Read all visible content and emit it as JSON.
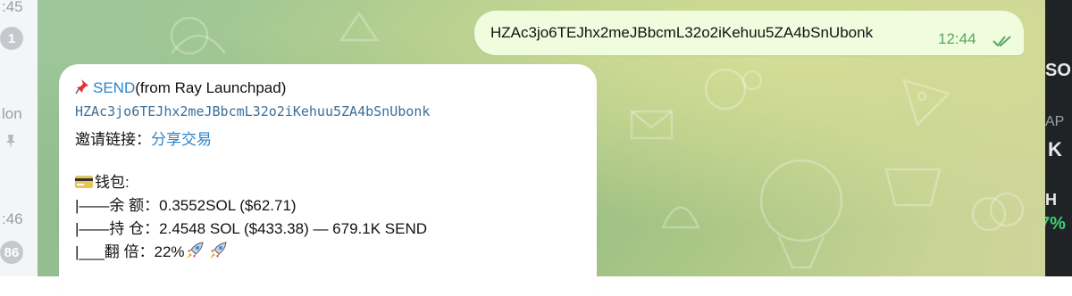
{
  "chat_list": {
    "time_1": ":45",
    "badge_1": "1",
    "name_fragment": "lon",
    "time_2": ":46",
    "badge_2": "86"
  },
  "right_panel": {
    "text_1": "SOL",
    "text_2": "AP",
    "text_3": "K",
    "text_4": "H",
    "text_5": "7%"
  },
  "outgoing_message": {
    "text": "HZAc3jo6TEJhx2meJBbcmL32o2iKehuu5ZA4bSnUbonk",
    "time": "12:44",
    "status_icon": "double-check-icon"
  },
  "incoming_message": {
    "token_link": "SEND",
    "token_source": "(from Ray Launchpad)",
    "address": "HZAc3jo6TEJhx2meJBbcmL32o2iKehuu5ZA4bSnUbonk",
    "invite_label": "邀请链接：",
    "invite_link": "分享交易",
    "wallet_label": "钱包:",
    "balance_line": "|——余  额：0.3552SOL ($62.71)",
    "position_line": "|——持  仓：2.4548 SOL ($433.38) — 679.1K SEND",
    "multiple_line": "|___翻  倍：22%"
  },
  "colors": {
    "outgoing_bubble": "#effdde",
    "link": "#2d84c9",
    "time_green": "#5aa363"
  }
}
